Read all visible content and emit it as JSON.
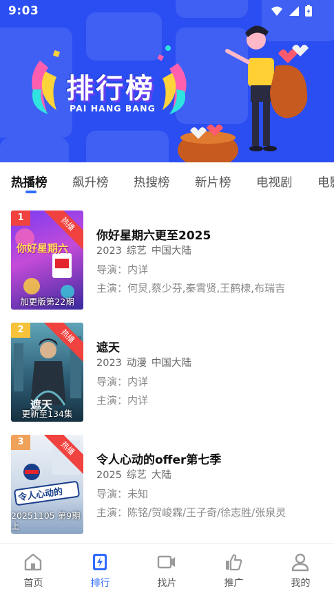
{
  "status_bar": {
    "time": "9:03"
  },
  "banner": {
    "title": "排行榜",
    "subtitle": "PAI HANG BANG"
  },
  "tabs": [
    {
      "label": "热播榜",
      "active": true
    },
    {
      "label": "飙升榜",
      "active": false
    },
    {
      "label": "热搜榜",
      "active": false
    },
    {
      "label": "新片榜",
      "active": false
    },
    {
      "label": "电视剧",
      "active": false
    },
    {
      "label": "电影",
      "active": false
    }
  ],
  "items": [
    {
      "rank": "1",
      "rank_color": "#f0423e",
      "badge": "热播",
      "poster_caption": "加更版第22期",
      "poster_logo": "你好星期六",
      "title": "你好星期六更至2025",
      "year": "2023",
      "genre": "综艺",
      "region": "中国大陆",
      "director": "导演：内详",
      "cast": "主演：何炅,蔡少芬,秦霄贤,王鹤棣,布瑞吉"
    },
    {
      "rank": "2",
      "rank_color": "#f5c23a",
      "badge": "热播",
      "poster_caption": "更新至134集",
      "poster_logo": "遮天",
      "title": "遮天",
      "year": "2023",
      "genre": "动漫",
      "region": "中国大陆",
      "director": "导演：内详",
      "cast": "主演：内详"
    },
    {
      "rank": "3",
      "rank_color": "#f0a15a",
      "badge": "热播",
      "poster_caption": "20251105 第9期上",
      "poster_logo": "令人心动的",
      "title": "令人心动的offer第七季",
      "year": "2025",
      "genre": "综艺",
      "region": "大陆",
      "director": "导演：未知",
      "cast": "主演：陈铭/贺峻霖/王子奇/徐志胜/张泉灵"
    }
  ],
  "bottom_nav": [
    {
      "label": "首页",
      "icon": "home-icon",
      "active": false
    },
    {
      "label": "排行",
      "icon": "ranking-icon",
      "active": true
    },
    {
      "label": "找片",
      "icon": "video-camera-icon",
      "active": false
    },
    {
      "label": "推广",
      "icon": "thumbs-up-icon",
      "active": false
    },
    {
      "label": "我的",
      "icon": "profile-icon",
      "active": false
    }
  ],
  "colors": {
    "accent": "#2f6bff",
    "banner_bg": "#2b4ef2",
    "hot_badge": "#f0423e"
  }
}
